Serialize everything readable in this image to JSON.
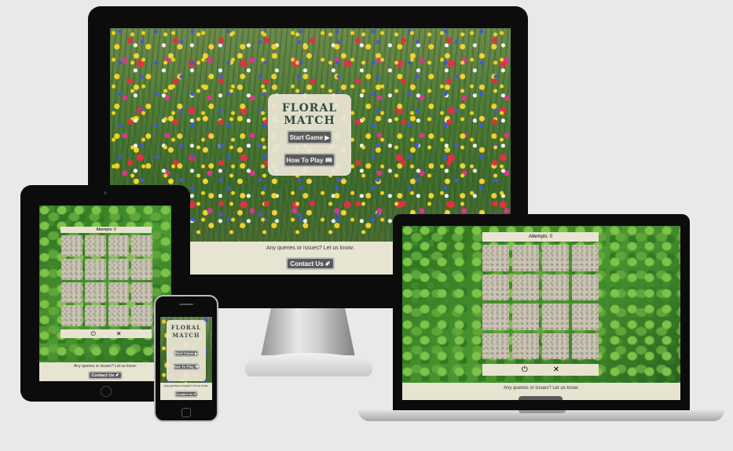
{
  "desktop": {
    "title": "FLORAL MATCH",
    "start_label": "Start Game ▶",
    "howto_label": "How To Play 📖",
    "footer_text": "Any queries or issues? Let us know:",
    "contact_label": "Contact Us ✐"
  },
  "tablet": {
    "attempts_label": "Attempts: 0",
    "power_icon": "⏻",
    "close_icon": "✕",
    "footer_text": "Any queries or issues? Let us know:",
    "contact_label": "Contact Us ✐"
  },
  "phone": {
    "title_line1": "FLORAL",
    "title_line2": "MATCH",
    "start_label": "Start Game ▶",
    "howto_label": "How To Play 📖",
    "footer_text": "Any queries or issues? Let us know:",
    "contact_label": "Contact Us ✐"
  },
  "laptop": {
    "attempts_label": "Attempts: 0",
    "power_icon": "⏻",
    "close_icon": "✕",
    "footer_text": "Any queries or issues? Let us know:"
  },
  "colors": {
    "button_bg": "#5a5a5a",
    "footer_bg": "#e8e4d2",
    "title_color": "#2f4a40"
  }
}
